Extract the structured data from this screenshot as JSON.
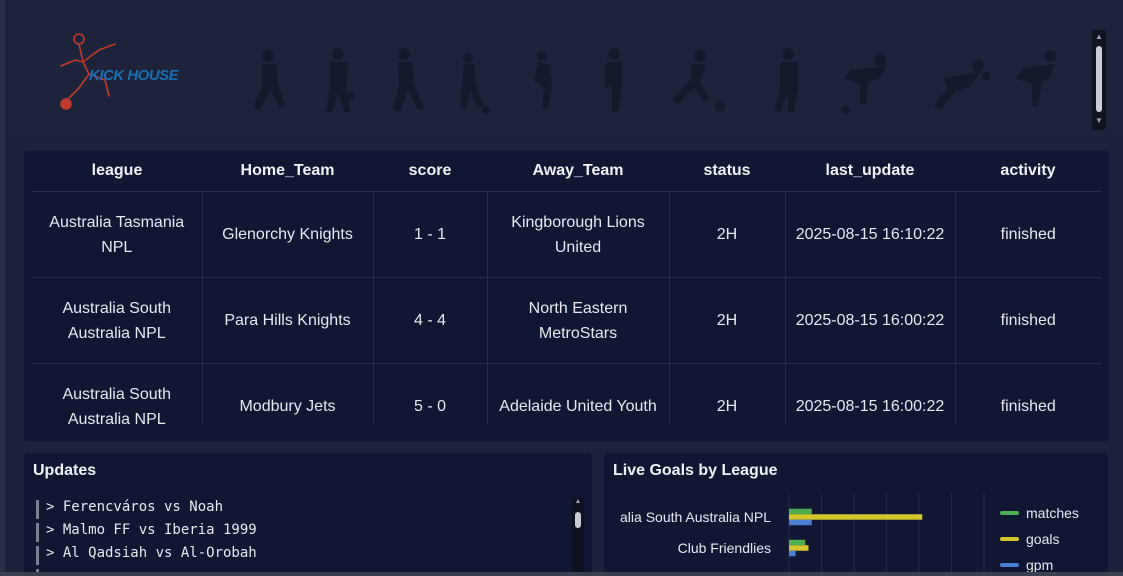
{
  "header": {
    "logo_text": "KICK HOUSE"
  },
  "table": {
    "columns": [
      "league",
      "Home_Team",
      "score",
      "Away_Team",
      "status",
      "last_update",
      "activity"
    ],
    "rows": [
      [
        "Australia Tasmania NPL",
        "Glenorchy Knights",
        "1 - 1",
        "Kingborough Lions United",
        "2H",
        "2025-08-15 16:10:22",
        "finished"
      ],
      [
        "Australia South Australia NPL",
        "Para Hills Knights",
        "4 - 4",
        "North Eastern MetroStars",
        "2H",
        "2025-08-15 16:00:22",
        "finished"
      ],
      [
        "Australia South Australia NPL",
        "Modbury Jets",
        "5 - 0",
        "Adelaide United Youth",
        "2H",
        "2025-08-15 16:00:22",
        "finished"
      ]
    ]
  },
  "updates": {
    "title": "Updates",
    "items": [
      "> Ferencváros vs Noah",
      "> Malmo FF vs Iberia 1999",
      "> Al Qadsiah vs Al-Orobah"
    ]
  },
  "goals": {
    "title": "Live Goals by League"
  },
  "chart_data": {
    "type": "bar",
    "orientation": "horizontal",
    "categories": [
      "alia South Australia NPL",
      "Club Friendlies"
    ],
    "series": [
      {
        "name": "matches",
        "values": [
          7,
          5
        ],
        "color": "#4caf50"
      },
      {
        "name": "goals",
        "values": [
          41,
          6
        ],
        "color": "#d4c62a"
      },
      {
        "name": "gpm",
        "values": [
          7,
          2
        ],
        "color": "#4a7fd4"
      }
    ],
    "xlim": [
      0,
      60
    ],
    "grid": true,
    "legend_placement": "right"
  },
  "colors": {
    "background": "#1b2239",
    "panel": "#111733",
    "logo_red": "#c0392b",
    "logo_blue": "#1a6fb0"
  },
  "icons": {
    "logo": "kicking-player-logo",
    "banner": "footballer-silhouettes"
  }
}
